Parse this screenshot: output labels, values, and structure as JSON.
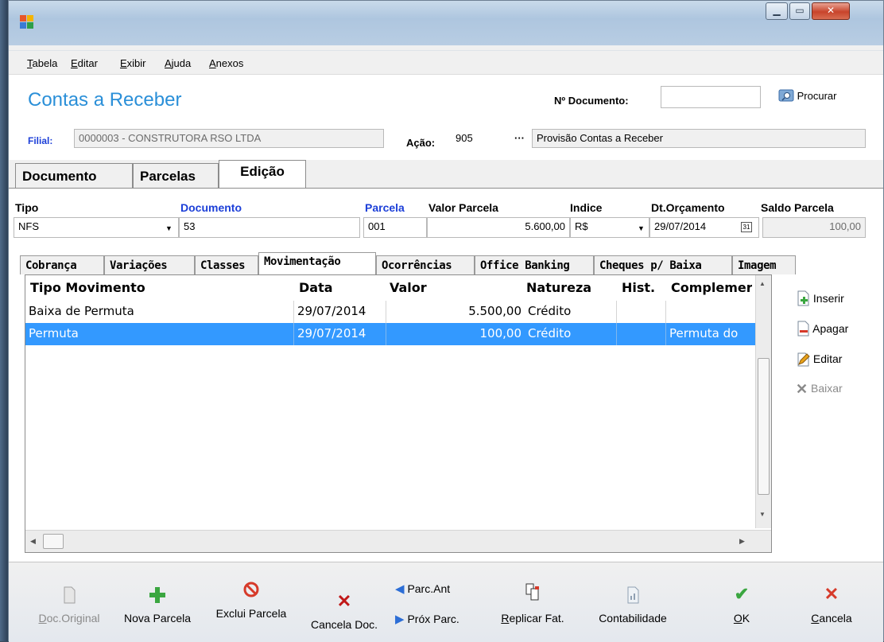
{
  "menu": [
    "Tabela",
    "Editar",
    "Exibir",
    "Ajuda",
    "Anexos"
  ],
  "header": {
    "title": "Contas a Receber",
    "doc_label": "Nº Documento:",
    "doc_value": "",
    "search_label": "Procurar",
    "filial_label": "Filial:",
    "filial_value": "0000003 - CONSTRUTORA RSO LTDA",
    "acao_label": "Ação:",
    "acao_value": "905",
    "acao_ellipsis": "···",
    "acao_desc": "Provisão Contas a Receber"
  },
  "main_tabs": [
    "Documento",
    "Parcelas",
    "Edição"
  ],
  "fields": {
    "tipo_label": "Tipo",
    "tipo_value": "NFS",
    "documento_label": "Documento",
    "documento_value": "53",
    "parcela_label": "Parcela",
    "parcela_value": "001",
    "valor_label": "Valor Parcela",
    "valor_value": "5.600,00",
    "indice_label": "Indice",
    "indice_value": "R$",
    "dt_label": "Dt.Orçamento",
    "dt_value": "29/07/2014",
    "saldo_label": "Saldo Parcela",
    "saldo_value": "100,00"
  },
  "sub_tabs": [
    "Cobrança",
    "Variações",
    "Classes",
    "Movimentação",
    "Ocorrências",
    "Office Banking",
    "Cheques p/ Baixa",
    "Imagem"
  ],
  "grid": {
    "columns": [
      "Tipo Movimento",
      "Data",
      "Valor",
      "Natureza",
      "Hist.",
      "Complemer"
    ],
    "rows": [
      [
        "Baixa de Permuta",
        "29/07/2014",
        "5.500,00",
        "Crédito",
        "",
        ""
      ],
      [
        "Permuta",
        "29/07/2014",
        "100,00",
        "Crédito",
        "",
        "Permuta do"
      ]
    ]
  },
  "side_buttons": [
    "Inserir",
    "Apagar",
    "Editar",
    "Baixar"
  ],
  "bottom_buttons": {
    "doc_original": "Doc.Original",
    "nova_parcela": "Nova Parcela",
    "exclui_parcela": "Exclui Parcela",
    "cancela_doc": "Cancela Doc.",
    "parc_ant": "Parc.Ant",
    "prox_parc": "Próx Parc.",
    "replicar": "Replicar Fat.",
    "contabilidade": "Contabilidade",
    "ok": "OK",
    "cancela": "Cancela"
  },
  "colors": {
    "accent": "#2a8fd8",
    "selection": "#3399ff",
    "label_blue": "#1c3fd8"
  }
}
